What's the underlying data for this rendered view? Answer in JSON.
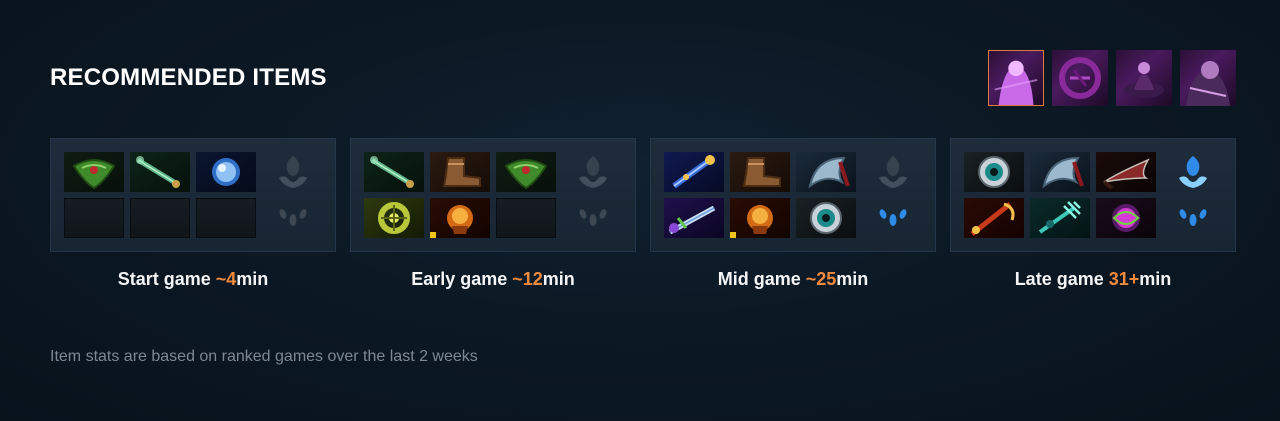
{
  "header": {
    "title": "RECOMMENDED ITEMS"
  },
  "portraits": [
    {
      "icon": "hero-portrait-icon",
      "active": true
    },
    {
      "icon": "hero-portrait-icon",
      "active": false
    },
    {
      "icon": "hero-portrait-icon",
      "active": false
    },
    {
      "icon": "hero-portrait-icon",
      "active": false
    }
  ],
  "phases": [
    {
      "label": "Start game ",
      "time": "~4",
      "unit": "min",
      "items": [
        [
          "wraith-band-icon",
          "magic-stick-icon",
          "orb-icon"
        ],
        [
          "empty",
          "empty",
          "empty"
        ]
      ],
      "neutral": [
        "neutral-token-icon",
        "neutral-tier-icon"
      ]
    },
    {
      "label": "Early game ",
      "time": "~12",
      "unit": "min",
      "items": [
        [
          "magic-stick-icon",
          "boots-icon",
          "wraith-band-icon"
        ],
        [
          "ring-icon",
          "gauntlet-icon",
          "empty"
        ]
      ],
      "neutral": [
        "neutral-token-icon",
        "neutral-tier-icon"
      ]
    },
    {
      "label": "Mid game ",
      "time": "~25",
      "unit": "min",
      "items": [
        [
          "scepter-icon",
          "boots-icon",
          "axe-icon"
        ],
        [
          "sword-icon",
          "gauntlet-icon",
          "eye-icon"
        ]
      ],
      "neutral": [
        "neutral-token-icon",
        "neutral-tier-active-icon"
      ]
    },
    {
      "label": "Late game ",
      "time": "31+",
      "unit": "min",
      "items": [
        [
          "eye-icon",
          "axe-icon",
          "blade-icon"
        ],
        [
          "dagger-icon",
          "trident-icon",
          "orb-purple-icon"
        ]
      ],
      "neutral": [
        "neutral-token-active-icon",
        "neutral-tier-active-icon"
      ]
    }
  ],
  "footnote": "Item stats are based on ranked games over the last 2 weeks",
  "colors": {
    "accent": "#f08a3c",
    "text": "#ffffff",
    "muted": "#7d8893",
    "panel": "#1b2836"
  }
}
